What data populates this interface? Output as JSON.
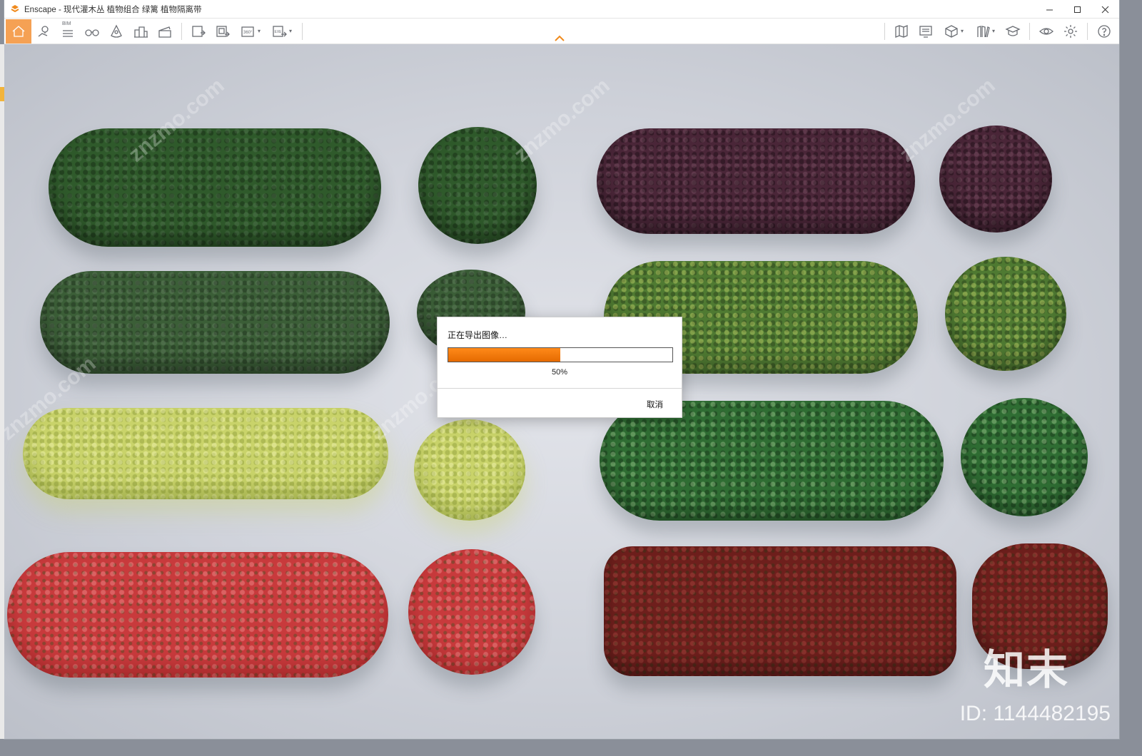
{
  "window": {
    "title": "Enscape - 现代灌木丛 植物组合 绿篱 植物隔离带"
  },
  "colors": {
    "accent": "#f5a154",
    "progress": "#ff8a1a",
    "caret": "#f08a1c"
  },
  "toolbar": {
    "bim_label": "BIM",
    "icons_left": [
      "home-icon",
      "map-pin-icon",
      "bim-list-icon",
      "binoculars-icon",
      "cone-icon",
      "buildings-icon",
      "clapper-icon",
      "screenshot-export-icon",
      "batch-export-icon",
      "panorama-360-icon",
      "exe-export-icon"
    ],
    "icons_right": [
      "map-icon",
      "monitor-icon",
      "cube-icon",
      "books-icon",
      "graduation-cap-icon",
      "eye-icon",
      "gear-icon",
      "help-icon"
    ],
    "badges": {
      "pano": "360°",
      "exe": "EXE"
    }
  },
  "dialog": {
    "title": "正在导出图像…",
    "progress": 0.5,
    "progress_text": "50%",
    "cancel_label": "取消"
  },
  "watermarks": {
    "site": "znzmo.com",
    "brand": "知末",
    "id": "ID: 1144482195"
  }
}
